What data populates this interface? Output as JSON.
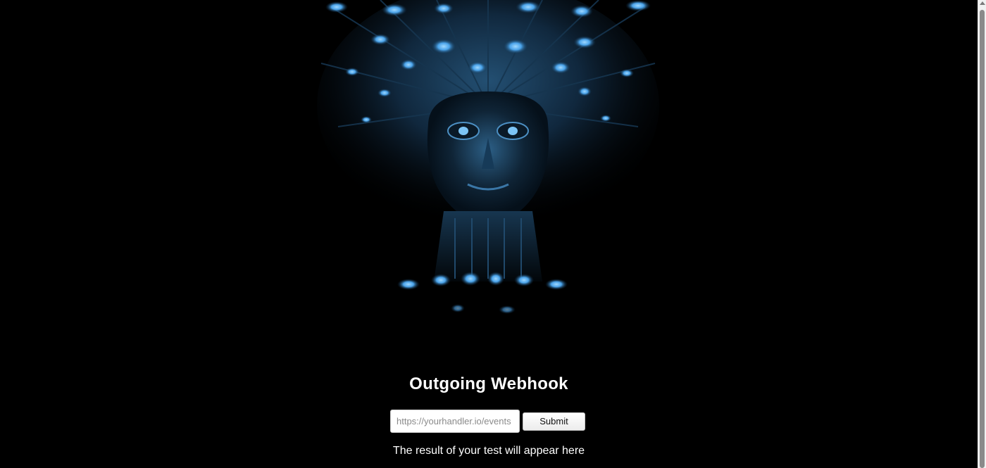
{
  "hero": {
    "image_name": "psychedelic-blue-face-artwork",
    "colors": {
      "background": "#000000",
      "glow": "#5fb6ff",
      "mid": "#1f4e78",
      "dark": "#0a1a2a"
    }
  },
  "page": {
    "title": "Outgoing Webhook",
    "result_text": "The result of your test will appear here"
  },
  "form": {
    "url_placeholder": "https://yourhandler.io/events",
    "url_value": "",
    "submit_label": "Submit"
  }
}
